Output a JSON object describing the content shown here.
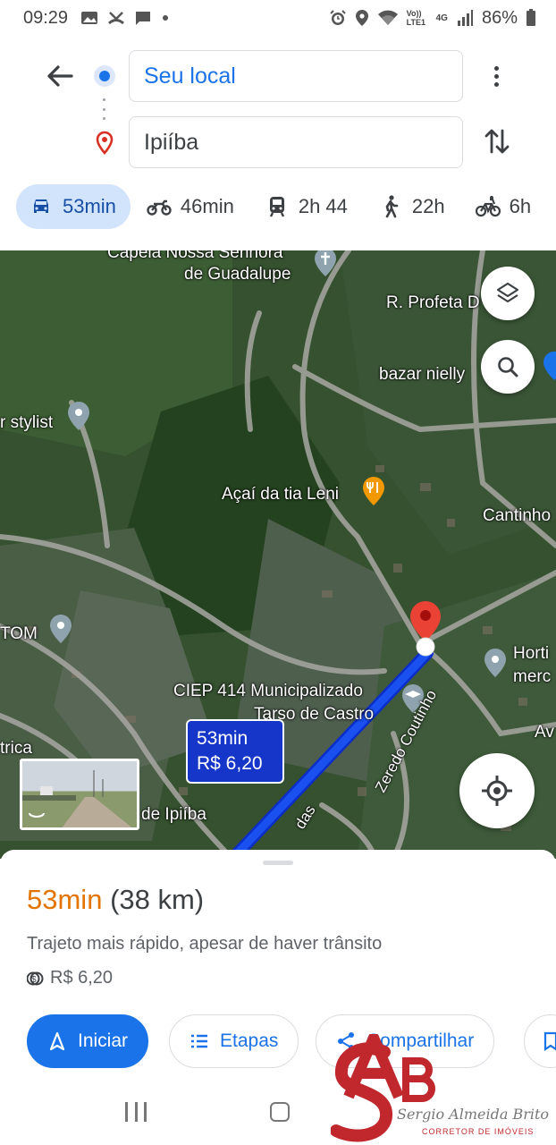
{
  "status_bar": {
    "time": "09:29",
    "left_icons": [
      "image-icon",
      "missed-call-icon",
      "message-icon",
      "dot-icon"
    ],
    "right_icons": [
      "alarm-icon",
      "location-icon",
      "wifi-icon",
      "volte-icon",
      "4g-icon",
      "signal-icon"
    ],
    "volte_label": "Vo)) LTE1",
    "network_label": "4G",
    "battery": "86%"
  },
  "route": {
    "origin": "Seu local",
    "destination": "Ipiíba"
  },
  "modes": [
    {
      "name": "car",
      "label": "53min",
      "active": true
    },
    {
      "name": "motorcycle",
      "label": "46min",
      "active": false
    },
    {
      "name": "transit",
      "label": "2h 44",
      "active": false
    },
    {
      "name": "walk",
      "label": "22h",
      "active": false
    },
    {
      "name": "bike",
      "label": "6h",
      "active": false
    }
  ],
  "map": {
    "labels": {
      "capela": "Capela Nossa Senhora",
      "guadalupe": "de Guadalupe",
      "profeta": "R. Profeta D",
      "bazar": "bazar nielly",
      "stylist": "r stylist",
      "acai": "Açaí da tia Leni",
      "cantinho": "Cantinho",
      "tom": "TOM",
      "horti": "Horti",
      "merc": "merc",
      "ciep1": "CIEP 414 Municipalizado",
      "ciep2": "Tarso de Castro",
      "av": "Av",
      "trica": "trica",
      "ipiiba": "de Ipiíba",
      "zeredo": "Zeredo Coutinho",
      "das": "das"
    },
    "callout": {
      "duration": "53min",
      "price": "R$ 6,20"
    },
    "route_color": "#1a4ff0"
  },
  "sheet": {
    "duration": "53min",
    "distance": "(38 km)",
    "description": "Trajeto mais rápido, apesar de haver trânsito",
    "toll": "R$ 6,20",
    "buttons": {
      "start": "Iniciar",
      "steps": "Etapas",
      "share": "Compartilhar"
    }
  },
  "watermark": {
    "letters": "AB",
    "signature": "Sergio Almeida Brito",
    "subtitle": "CORRETOR DE IMÓVEIS"
  },
  "colors": {
    "accent": "#1a73e8",
    "duration": "#e37400",
    "active_tab": "#d2e3fc",
    "destination_pin": "#d93025",
    "watermark": "#c0282d"
  }
}
